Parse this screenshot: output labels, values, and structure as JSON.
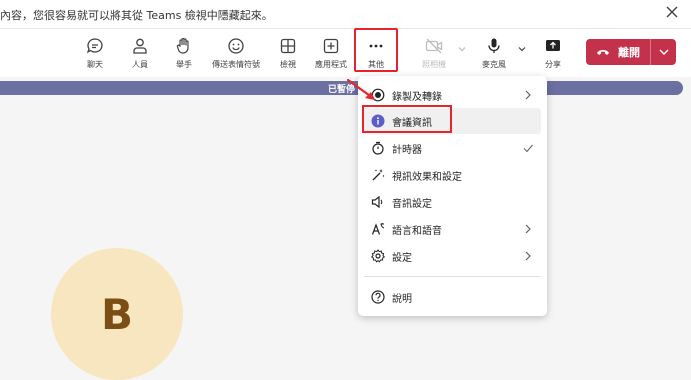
{
  "notice": {
    "text": "內容，您很容易就可以將其從 Teams 檢視中隱藏起來。"
  },
  "toolbar": {
    "items": [
      {
        "id": "chat",
        "label": "聊天",
        "icon": "chat-icon"
      },
      {
        "id": "people",
        "label": "人員",
        "icon": "people-icon"
      },
      {
        "id": "raise",
        "label": "舉手",
        "icon": "hand-icon"
      },
      {
        "id": "react",
        "label": "傳送表情符號",
        "icon": "emoji-icon"
      },
      {
        "id": "view",
        "label": "檢視",
        "icon": "grid-icon"
      },
      {
        "id": "apps",
        "label": "應用程式",
        "icon": "add-app-icon"
      },
      {
        "id": "more",
        "label": "其他",
        "icon": "more-icon"
      },
      {
        "id": "camera",
        "label": "照相機",
        "icon": "camera-off-icon"
      },
      {
        "id": "mic",
        "label": "麥克風",
        "icon": "mic-icon"
      },
      {
        "id": "share",
        "label": "分享",
        "icon": "share-icon"
      }
    ],
    "leave_label": "離開"
  },
  "status": {
    "paused": "已暫停"
  },
  "menu": {
    "items": [
      {
        "label": "錄製及轉錄",
        "icon": "record-icon"
      },
      {
        "label": "會議資訊",
        "icon": "info-icon"
      },
      {
        "label": "計時器",
        "icon": "timer-icon"
      },
      {
        "label": "視訊效果和設定",
        "icon": "effects-icon"
      },
      {
        "label": "音訊設定",
        "icon": "speaker-icon"
      },
      {
        "label": "語言和語音",
        "icon": "language-icon"
      },
      {
        "label": "設定",
        "icon": "gear-icon"
      },
      {
        "label": "說明",
        "icon": "help-icon"
      }
    ]
  },
  "participant": {
    "initial": "B"
  },
  "colors": {
    "leave": "#c4314b",
    "paused_bar": "#6b6fa1",
    "highlight": "#e8232b",
    "avatar_bg": "#f8e6c0",
    "info_icon": "#5b5fc7"
  }
}
